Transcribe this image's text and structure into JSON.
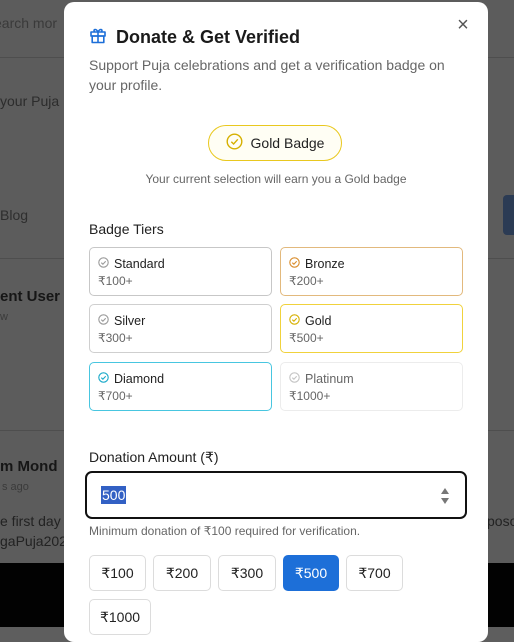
{
  "background": {
    "search_placeholder": "earch mor",
    "puja_text": "your Puja",
    "blog_text": "Blog",
    "user_text": "ent User",
    "user_sub": "w",
    "post_title": "m Mond",
    "post_time": "s ago",
    "post_line1": "e first day o",
    "post_line2": "gaPuja202",
    "post_trailing": "posolu"
  },
  "modal": {
    "title": "Donate & Get Verified",
    "title_icon": "gift-icon",
    "subtitle": "Support Puja celebrations and get a verification badge on your profile.",
    "close_label": "×",
    "selected_badge": "Gold Badge",
    "selection_note": "Your current selection will earn you a Gold badge",
    "tiers_label": "Badge Tiers",
    "tiers": [
      {
        "name": "Standard",
        "price": "₹100+",
        "color": "#9a9a9a"
      },
      {
        "name": "Bronze",
        "price": "₹200+",
        "color": "#d98c2b"
      },
      {
        "name": "Silver",
        "price": "₹300+",
        "color": "#9a9a9a"
      },
      {
        "name": "Gold",
        "price": "₹500+",
        "color": "#d6b000"
      },
      {
        "name": "Diamond",
        "price": "₹700+",
        "color": "#19a9c9"
      },
      {
        "name": "Platinum",
        "price": "₹1000+",
        "color": "#c4c4c4"
      }
    ],
    "amount_label": "Donation Amount (₹)",
    "amount_value": "500",
    "min_note": "Minimum donation of ₹100 required for verification.",
    "preset_amounts": [
      "₹100",
      "₹200",
      "₹300",
      "₹500",
      "₹700",
      "₹1000"
    ],
    "selected_amount": "₹500",
    "colors": {
      "accent": "#1d6fd8",
      "gold": "#e9c81f"
    }
  }
}
